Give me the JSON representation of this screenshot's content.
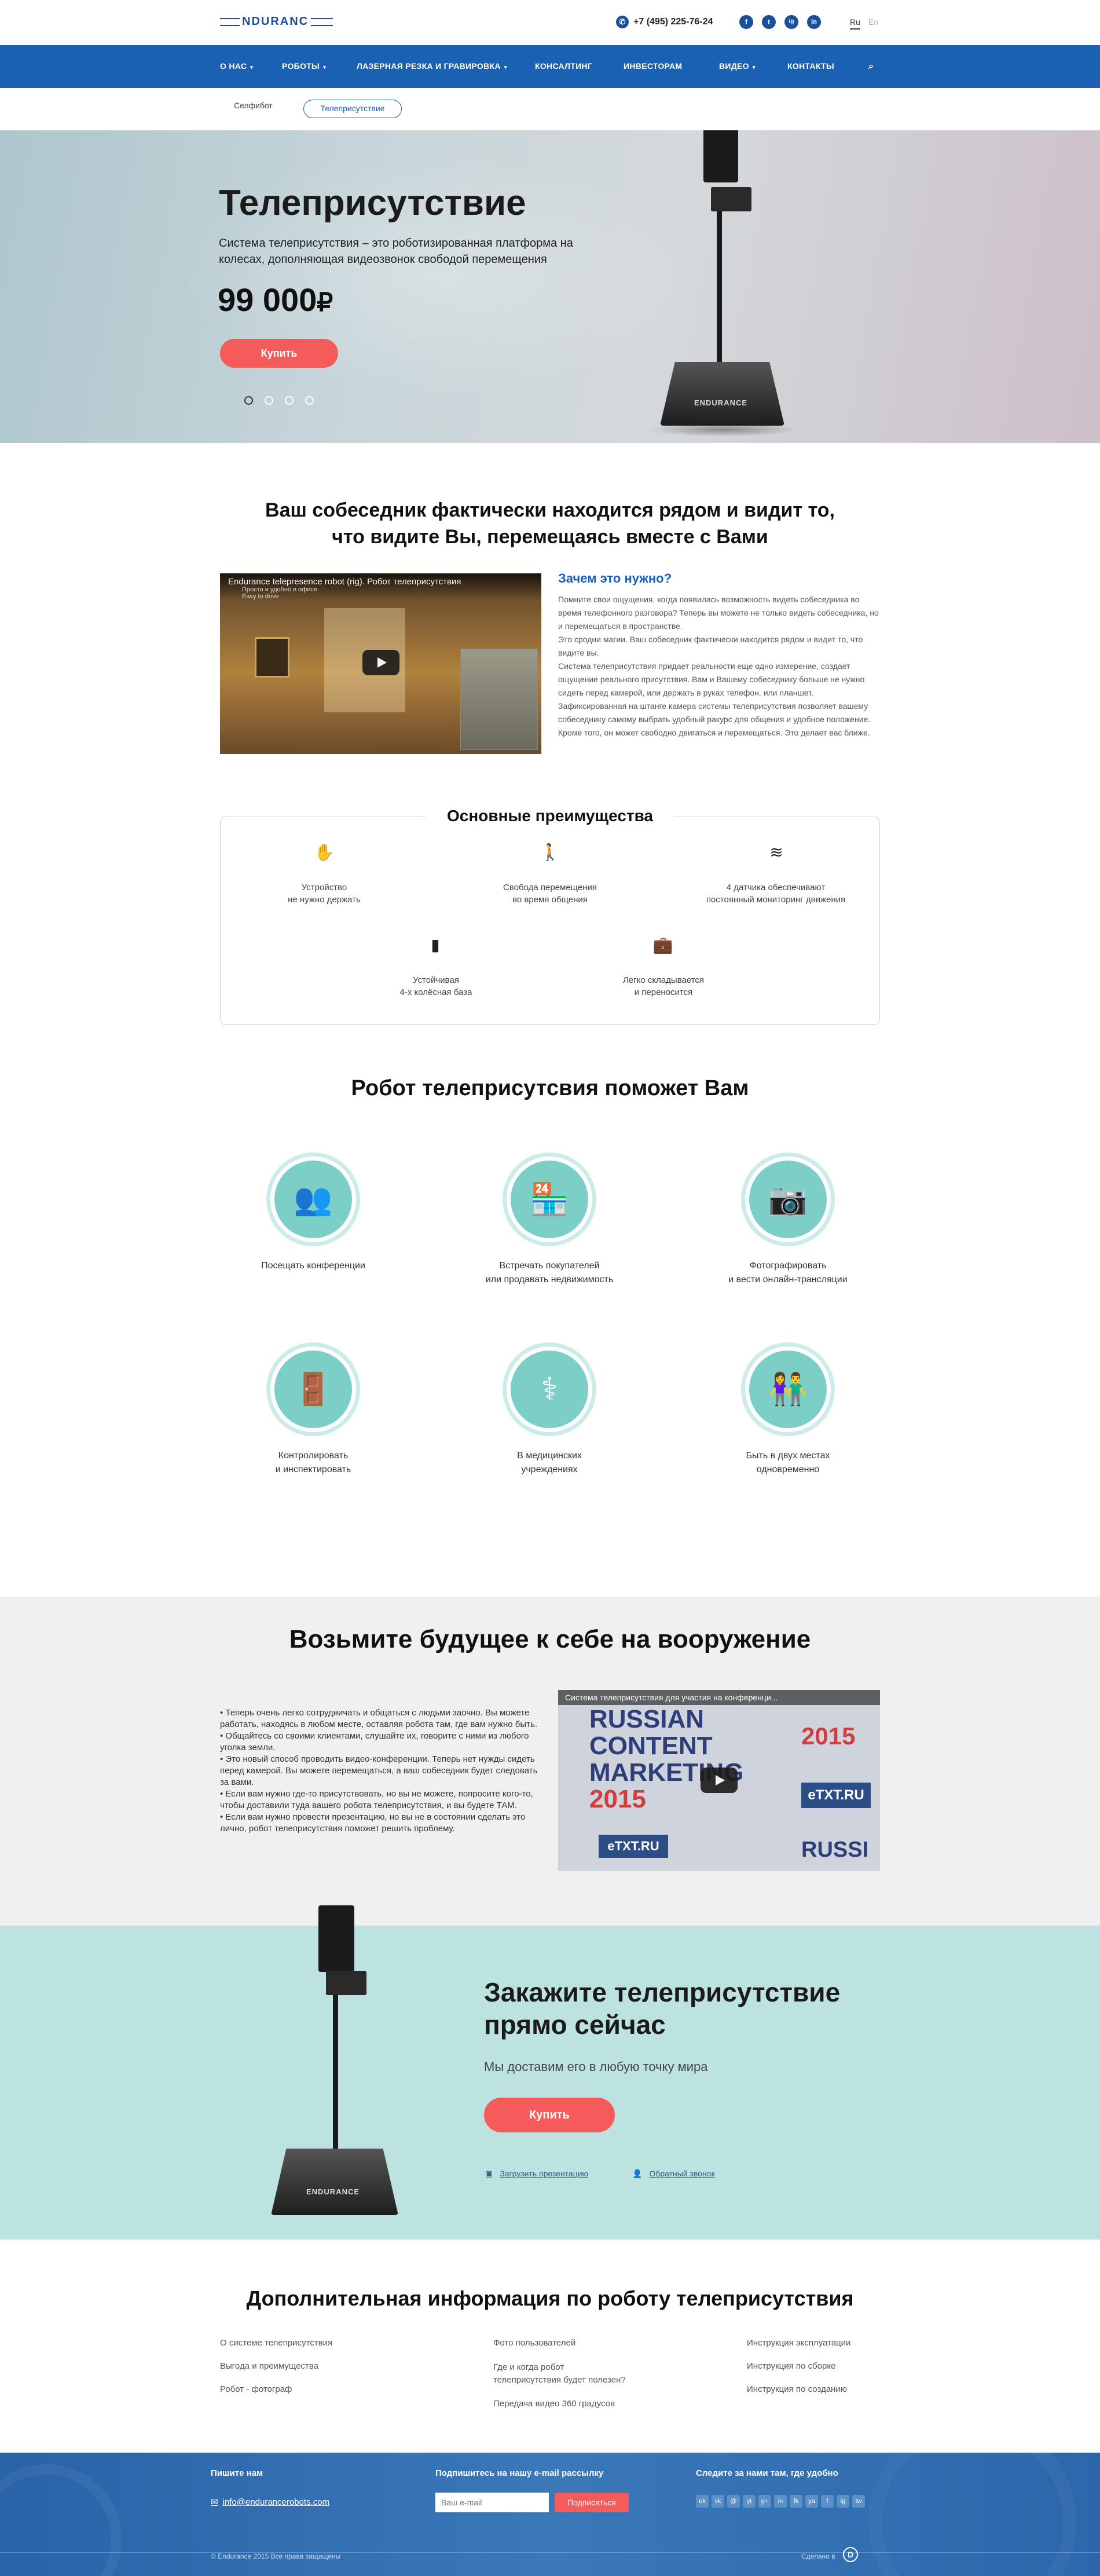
{
  "header": {
    "logo": "NDURANC",
    "phone": "+7 (495) 225-76-24",
    "social": [
      "f",
      "t",
      "ig",
      "in"
    ],
    "lang_active": "Ru",
    "lang_other": "En"
  },
  "nav": {
    "items": [
      "О НАС",
      "РОБОТЫ",
      "ЛАЗЕРНАЯ РЕЗКА И ГРАВИРОВКА",
      "КОНСАЛТИНГ",
      "ИНВЕСТОРАМ",
      "ВИДЕО",
      "КОНТАКТЫ"
    ]
  },
  "subnav": {
    "item1": "Селфибот",
    "item2": "Телеприсутствие"
  },
  "hero": {
    "title": "Телеприсутствие",
    "desc": "Система телеприсутствия – это роботизированная платформа на колесах, дополняющая видеозвонок свободой перемещения",
    "price": "99 000",
    "currency": "₽",
    "buy": "Купить",
    "robot_label": "ENDURANCE"
  },
  "intro": {
    "title": "Ваш собеседник фактически находится рядом и видит то, что видите Вы, перемещаясь вместе с Вами",
    "video_title": "Endurance telepresence robot (rig). Робот телеприсутствия",
    "video_sub": "Просто и удобно в офисе.",
    "video_sub2": "Easy to drive",
    "why_title": "Зачем это нужно?",
    "why_text": [
      "Помните свои ощущения, когда появилась возможность видеть собеседника во время телефонного разговора? Теперь вы можете не только видеть собеседника, но и перемещаться в пространстве.",
      "Это сродни магии. Ваш собеседник фактически находится рядом и видит то, что видите вы.",
      "Система телеприсутствия придает реальности еще одно измерение, создает ощущение реального присутствия. Вам и Вашему собеседнику больше не нужно сидеть перед камерой, или держать в руках телефон, или планшет.",
      "Зафиксированная на штанге камера системы телеприсутствия позволяет вашему собеседнику самому выбрать удобный ракурс для общения и удобное положение. Кроме того, он может свободно двигаться и перемещаться. Это делает вас ближе."
    ]
  },
  "advantages": {
    "title": "Основные преимущества",
    "items": [
      {
        "icon": "hand-icon",
        "glyph": "✋",
        "line1": "Устройство",
        "line2": "не нужно держать"
      },
      {
        "icon": "walking-person-icon",
        "glyph": "🚶",
        "line1": "Свобода перемещения",
        "line2": "во время общения"
      },
      {
        "icon": "sensor-icon",
        "glyph": "≋",
        "line1": "4 датчика обеспечивают",
        "line2": "постоянный мониторинг движения"
      },
      {
        "icon": "tire-icon",
        "glyph": "▮",
        "line1": "Устойчивая",
        "line2": "4-х колёсная база"
      },
      {
        "icon": "briefcase-icon",
        "glyph": "💼",
        "line1": "Легко складывается",
        "line2": "и переносится"
      }
    ]
  },
  "help": {
    "title": "Робот телеприсутсвия поможет Вам",
    "items": [
      {
        "icon": "conference-icon",
        "glyph": "👥",
        "line1": "Посещать конференции",
        "line2": ""
      },
      {
        "icon": "shop-icon",
        "glyph": "🏪",
        "line1": "Встречать покупателей",
        "line2": "или продавать недвижимость"
      },
      {
        "icon": "photo-icon",
        "glyph": "📷",
        "line1": "Фотографировать",
        "line2": "и вести онлайн-трансляции"
      },
      {
        "icon": "inspection-gate-icon",
        "glyph": "🚪",
        "line1": "Контролировать",
        "line2": "и инспектировать"
      },
      {
        "icon": "caduceus-icon",
        "glyph": "⚕",
        "line1": "В медицинских",
        "line2": "учреждениях"
      },
      {
        "icon": "two-people-icon",
        "glyph": "👫",
        "line1": "Быть в двух местах",
        "line2": "одновременно"
      }
    ]
  },
  "future": {
    "title": "Возьмите будущее к себе на вооружение",
    "bullets": [
      "• Теперь очень легко сотрудничать и общаться с людьми заочно. Вы можете работать, находясь в любом месте, оставляя робота там, где вам нужно быть.",
      "• Общайтесь со своими клиентами, слушайте их, говорите с ними из любого уголка земли.",
      "• Это новый способ проводить видео-конференции. Теперь нет нужды сидеть перед камерой. Вы можете перемещаться, а ваш собеседник будет следовать за вами.",
      "• Если вам нужно где-то присутствовать, но вы не можете, попросите кого-то, чтобы доставили туда вашего робота телеприсутствия, и вы будете ТАМ.",
      "• Если вам нужно провести презентацию, но вы не в состоянии сделать это лично, робот телеприсутствия поможет решить проблему."
    ],
    "video_title": "Система телеприсутствия для участия на конференци...",
    "video_lines": [
      "RUSSIAN",
      "CONTENT",
      "MARKETING",
      "2015"
    ],
    "video_year": "2015",
    "video_brand": "eTXT.RU",
    "video_brand2": "eTXT.RU",
    "video_russ": "RUSSI"
  },
  "order": {
    "title_line1": "Закажите телеприсутствие",
    "title_line2": "прямо сейчас",
    "subtitle": "Мы доставим его в любую точку мира",
    "buy": "Купить",
    "link1": "Загрузить презентацию",
    "link2": "Обратный звонок",
    "robot_label": "ENDURANCE"
  },
  "info": {
    "title": "Дополнительная информация по роботу телеприсутствия",
    "col1": [
      "О системе телеприсутствия",
      "Выгода и преимущества",
      "Робот - фотограф"
    ],
    "col2": [
      "Фото пользователей",
      "Где и когда робот",
      "телеприсутствия будет полезен?",
      "Передача видео 360 градусов"
    ],
    "col3": [
      "Инструкция эксплуатации",
      "Инструкция по сборке",
      "Инструкция по созданию"
    ]
  },
  "footer": {
    "write_title": "Пишите нам",
    "email": "info@endurancerobots.com",
    "subscribe_title": "Подпишитесь на нашу e-mail рассылку",
    "email_placeholder": "Ваш e-mail",
    "subscribe_btn": "Подписаться",
    "follow_title": "Следите за нами там, где удобно",
    "social": [
      "ok",
      "vk",
      "@",
      "yt",
      "g+",
      "in",
      "fk",
      "ya",
      "f",
      "ig",
      "tw"
    ],
    "copyright": "© Endurance 2015 Все права защищены",
    "made_by": "Сделано в"
  },
  "colors": {
    "brand": "#1a61b3",
    "accent": "#f45c5c",
    "teal": "#7ccfc7",
    "teal_bg": "#bde3e0"
  }
}
